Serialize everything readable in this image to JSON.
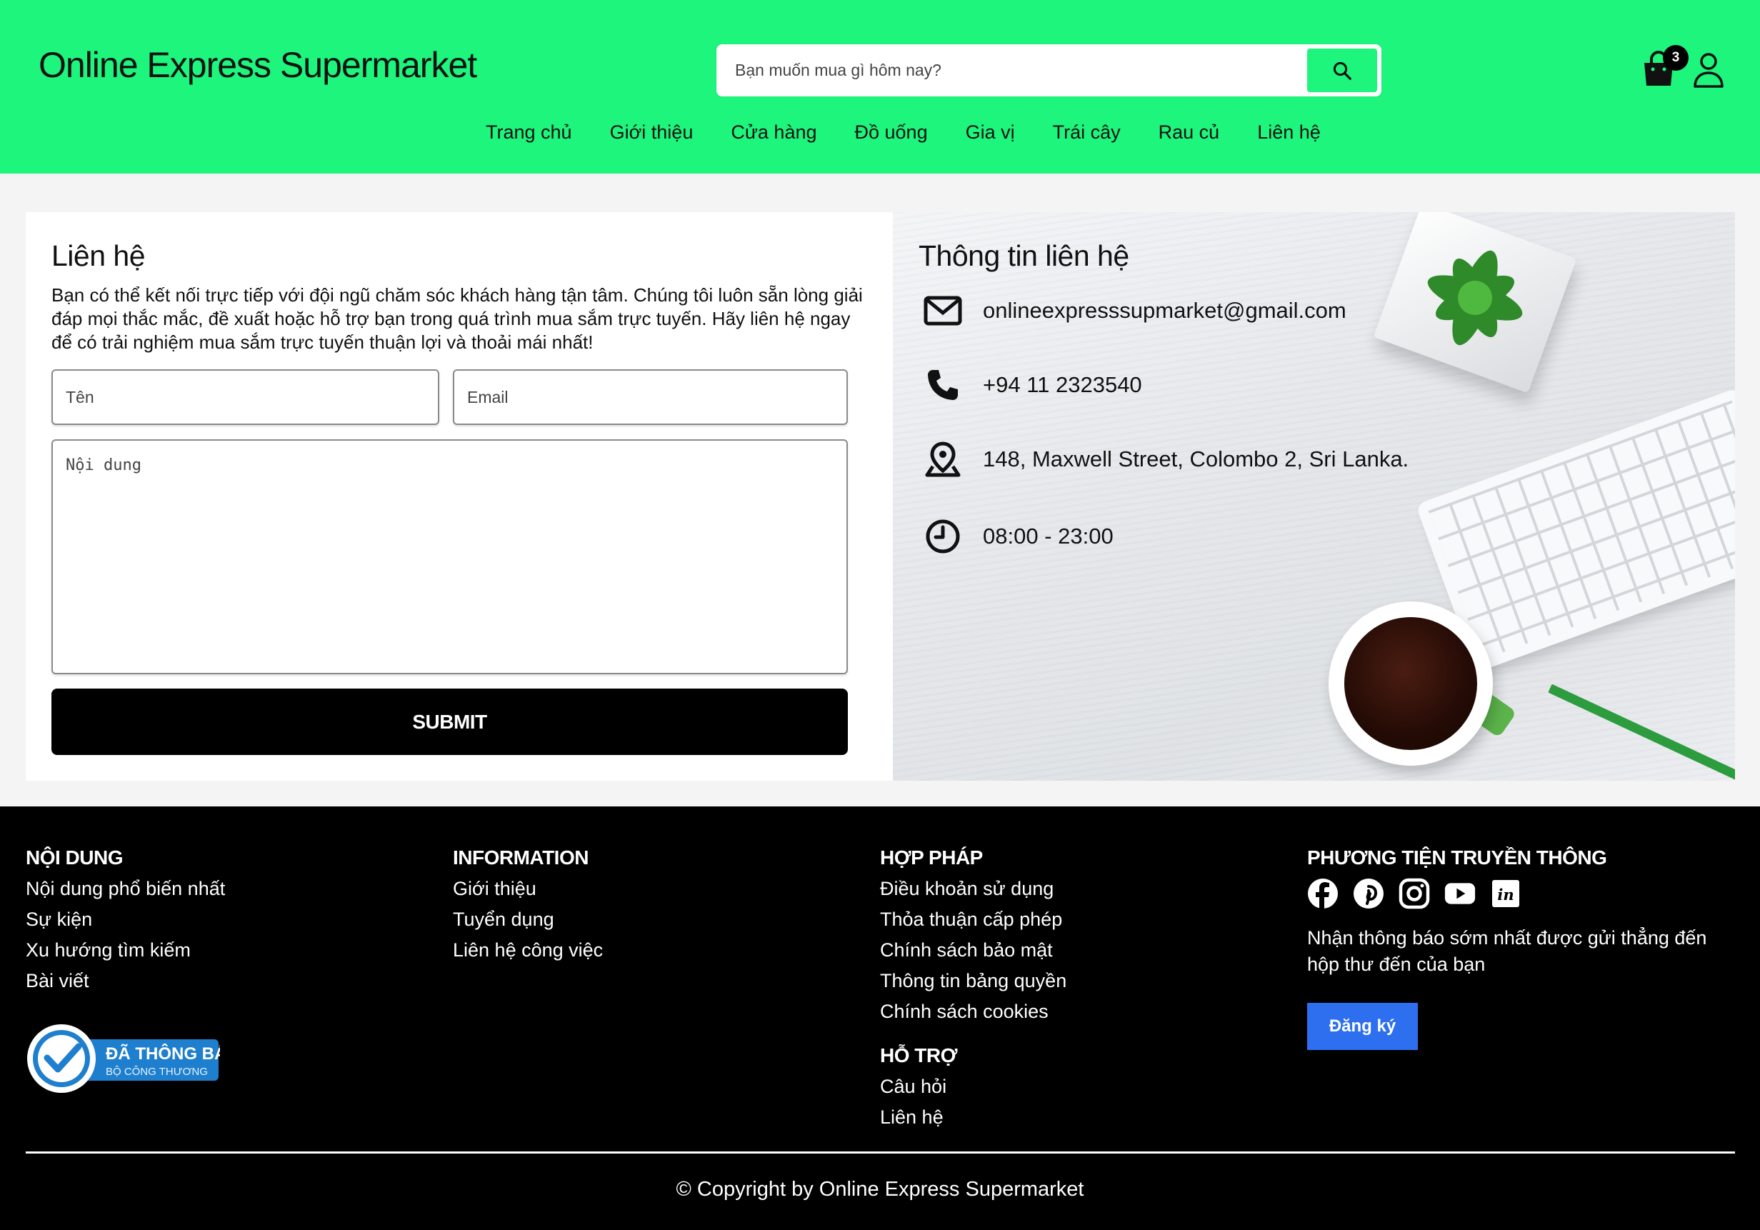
{
  "header": {
    "brand": "Online Express Supermarket",
    "search_placeholder": "Bạn muốn mua gì hôm nay?",
    "cart_count": "3",
    "nav": [
      "Trang chủ",
      "Giới thiệu",
      "Cửa hàng",
      "Đồ uống",
      "Gia vị",
      "Trái cây",
      "Rau củ",
      "Liên hệ"
    ],
    "accent_color": "#1df57c"
  },
  "contact": {
    "title": "Liên hệ",
    "description": "Bạn có thể kết nối trực tiếp với đội ngũ chăm sóc khách hàng tận tâm. Chúng tôi luôn sẵn lòng giải đáp mọi thắc mắc, đề xuất hoặc hỗ trợ bạn trong quá trình mua sắm trực tuyến. Hãy liên hệ ngay để có trải nghiệm mua sắm trực tuyến thuận lợi và thoải mái nhất!",
    "name_placeholder": "Tên",
    "email_placeholder": "Email",
    "message_placeholder": "Nội dung",
    "submit_label": "SUBMIT"
  },
  "info": {
    "title": "Thông tin liên hệ",
    "email": "onlineexpresssupmarket@gmail.com",
    "phone": "+94 11 2323540",
    "address": "148, Maxwell Street, Colombo 2, Sri Lanka.",
    "hours": "08:00 - 23:00"
  },
  "footer": {
    "col1": {
      "title": "NỘI DUNG",
      "links": [
        "Nội dung phổ biến nhất",
        "Sự kiện",
        "Xu hướng tìm kiếm",
        "Bài viết"
      ]
    },
    "col2": {
      "title": "INFORMATION",
      "links": [
        "Giới thiệu",
        "Tuyển dụng",
        "Liên hệ công việc"
      ]
    },
    "col3": {
      "title": "HỢP PHÁP",
      "links": [
        "Điều khoản sử dụng",
        "Thỏa thuận cấp phép",
        "Chính sách bảo mật",
        "Thông tin bảng quyền",
        "Chính sách cookies"
      ]
    },
    "col3b": {
      "title": "HỖ TRỢ",
      "links": [
        "Câu hỏi",
        "Liên hệ"
      ]
    },
    "col4": {
      "title": "PHƯƠNG TIỆN TRUYỀN THÔNG",
      "newsletter": "Nhận thông báo sớm nhất được gửi thẳng đến hộp thư đến của bạn",
      "subscribe_label": "Đăng ký"
    },
    "badge": {
      "line1": "ĐÃ THÔNG BÁO",
      "line2": "BỘ CÔNG THƯƠNG"
    },
    "copyright": "Copyright by Online Express Supermarket",
    "subscribe_color": "#2d6fee"
  }
}
